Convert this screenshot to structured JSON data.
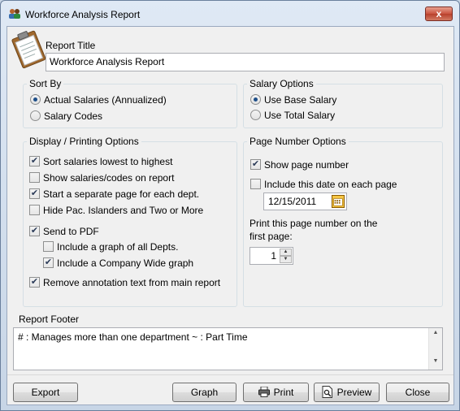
{
  "window": {
    "title": "Workforce Analysis Report",
    "close_label": "x"
  },
  "report_title": {
    "label": "Report Title",
    "value": "Workforce Analysis Report"
  },
  "sort_by": {
    "label": "Sort By",
    "options": [
      {
        "label": "Actual Salaries (Annualized)",
        "checked": true
      },
      {
        "label": "Salary Codes",
        "checked": false
      }
    ]
  },
  "salary_options": {
    "label": "Salary Options",
    "options": [
      {
        "label": "Use Base Salary",
        "checked": true
      },
      {
        "label": "Use Total Salary",
        "checked": false
      }
    ]
  },
  "display_printing": {
    "label": "Display / Printing Options",
    "items": [
      {
        "label": "Sort salaries lowest to highest",
        "checked": true
      },
      {
        "label": "Show salaries/codes on report",
        "checked": false
      },
      {
        "label": "Start a separate page for each dept.",
        "checked": true
      },
      {
        "label": "Hide Pac. Islanders and Two or More",
        "checked": false
      },
      {
        "label": "Send to PDF",
        "checked": true
      },
      {
        "label": "Include a graph of all Depts.",
        "checked": false
      },
      {
        "label": "Include a Company Wide graph",
        "checked": true
      },
      {
        "label": "Remove annotation text from main report",
        "checked": true
      }
    ]
  },
  "page_number": {
    "label": "Page Number Options",
    "show_page_number": {
      "label": "Show page number",
      "checked": true
    },
    "include_date": {
      "label": "Include this date on each page",
      "checked": false
    },
    "date_value": "12/15/2011",
    "first_page_label_line1": "Print this page number on the",
    "first_page_label_line2": "first page:",
    "first_page_value": "1"
  },
  "footer": {
    "label": "Report Footer",
    "text": "# : Manages more than one department  ~ : Part Time"
  },
  "buttons": {
    "export": "Export",
    "graph": "Graph",
    "print": "Print",
    "preview": "Preview",
    "close": "Close"
  },
  "icons": {
    "title": "people-icon",
    "report": "clipboard-icon",
    "calendar": "calendar-icon",
    "print": "printer-icon",
    "preview": "document-preview-icon"
  }
}
